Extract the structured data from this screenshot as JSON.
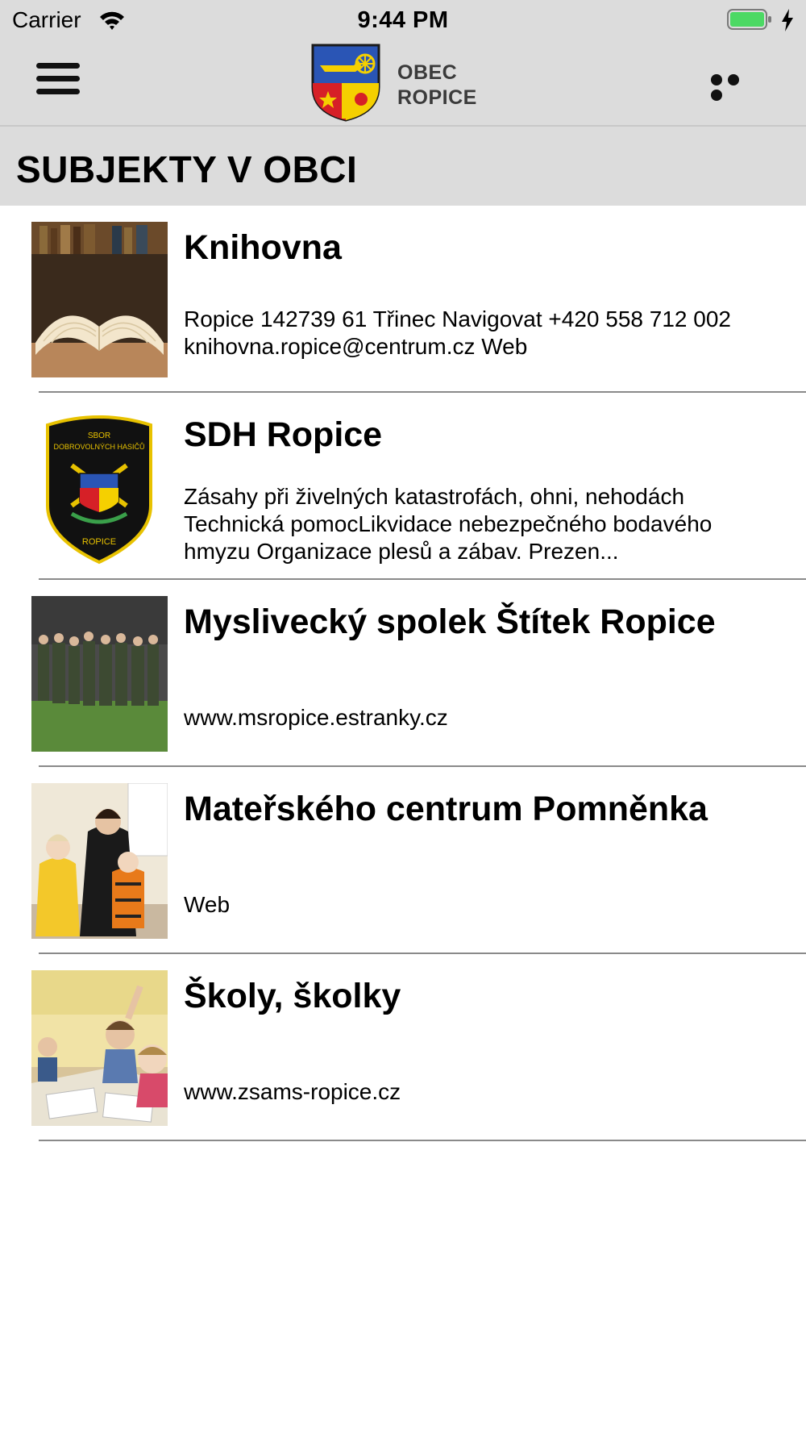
{
  "status_bar": {
    "carrier": "Carrier",
    "time": "9:44 PM",
    "battery_color": "#4cd964"
  },
  "nav": {
    "logo_line1": "OBEC",
    "logo_line2": "ROPICE"
  },
  "section": {
    "title": "SUBJEKTY V OBCI"
  },
  "items": [
    {
      "title": "Knihovna",
      "description": "Ropice 142739 61 Třinec   Navigovat  +420 558 712 002  knihovna.ropice@centrum.cz  Web",
      "thumbnail": "open-book-photo"
    },
    {
      "title": "SDH Ropice",
      "description": "Zásahy při živelných katastrofách, ohni, nehodách Technická pomocLikvidace nebezpečného bodavého hmyzu Organizace plesů a zábav. Prezen...",
      "thumbnail": "firefighters-badge",
      "badge_text_top": "SBOR",
      "badge_text_arc": "DOBROVOLNÝCH HASIČŮ",
      "badge_text_bottom": "ROPICE"
    },
    {
      "title": "Myslivecký spolek Štítek Ropice",
      "description": "www.msropice.estranky.cz",
      "thumbnail": "group-photo"
    },
    {
      "title": "Mateřského centrum Pomněnka",
      "description": "Web",
      "thumbnail": "mother-children-photo"
    },
    {
      "title": "Školy, školky",
      "description": "www.zsams-ropice.cz",
      "thumbnail": "classroom-photo"
    }
  ],
  "colors": {
    "bar_gray": "#dcdcdc",
    "divider": "#8a8a8a",
    "crest_blue": "#2a55b5",
    "crest_red": "#d62027",
    "crest_yellow": "#f5d000"
  }
}
